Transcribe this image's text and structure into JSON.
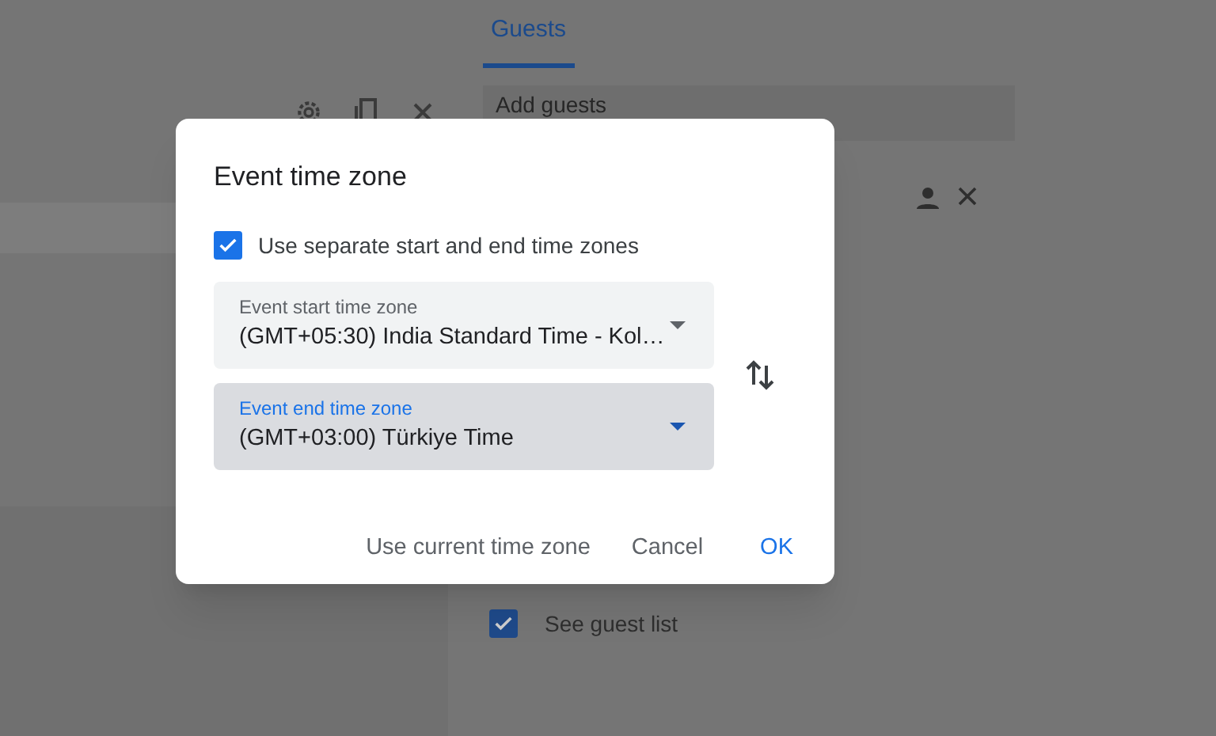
{
  "background": {
    "tabs": [
      {
        "label": "Guests",
        "selected": true
      }
    ],
    "guest_field": {
      "placeholder": "Add guests"
    },
    "guest_permissions": [
      {
        "label": "See guest list",
        "checked": true
      }
    ]
  },
  "dialog": {
    "title": "Event time zone",
    "separate_zones": {
      "label": "Use separate start and end time zones",
      "checked": true
    },
    "fields": [
      {
        "label": "Event start time zone",
        "value": "(GMT+05:30) India Standard Time - Kol…",
        "focused": false
      },
      {
        "label": "Event end time zone",
        "value": "(GMT+03:00) Türkiye Time",
        "focused": true
      }
    ],
    "buttons": [
      {
        "label": "Use current time zone",
        "kind": "secondary"
      },
      {
        "label": "Cancel",
        "kind": "secondary"
      },
      {
        "label": "OK",
        "kind": "primary"
      }
    ]
  }
}
